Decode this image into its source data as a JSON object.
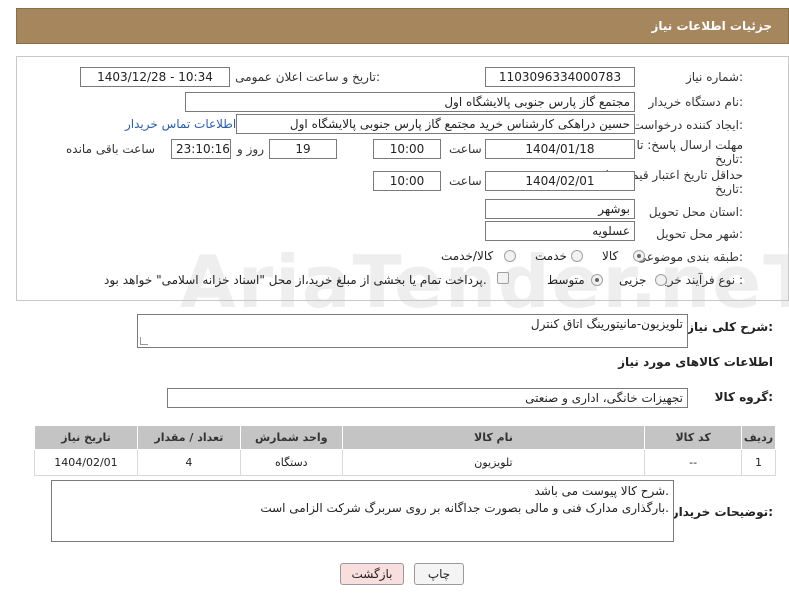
{
  "header": {
    "title": "جزئیات اطلاعات نیاز"
  },
  "form": {
    "need_number_label": "شماره نیاز:",
    "need_number": "1103096334000783",
    "announce_label": "تاریخ و ساعت اعلان عمومی:",
    "announce_value": "1403/12/28 - 10:34",
    "buyer_org_label": "نام دستگاه خریدار:",
    "buyer_org": "مجتمع گاز پارس جنوبی  پالایشگاه اول",
    "creator_label": "ایجاد کننده درخواست:",
    "creator": "حسین دراهکی کارشناس خرید مجتمع گاز پارس جنوبی  پالایشگاه اول",
    "buyer_contact_link": "اطلاعات تماس خریدار",
    "deadline_label_1": "مهلت ارسال پاسخ: تا",
    "deadline_label_2": "تاریخ:",
    "deadline_date": "1404/01/18",
    "time_label": "ساعت",
    "deadline_time": "10:00",
    "days_value": "19",
    "days_label": "روز و",
    "remaining_time": "23:10:16",
    "remaining_label": "ساعت باقی مانده",
    "validity_label_1": "حداقل تاریخ اعتبار قیمت: تا",
    "validity_label_2": "تاریخ:",
    "validity_date": "1404/02/01",
    "validity_time": "10:00",
    "province_label": "استان محل تحویل:",
    "province": "بوشهر",
    "city_label": "شهر محل تحویل:",
    "city": "عسلویه",
    "category_label": "طبقه بندی موضوعی:",
    "category_goods": "کالا",
    "category_service": "خدمت",
    "category_goods_service": "کالا/خدمت",
    "process_label": "نوع فرآیند خرید :",
    "process_partial": "جزیی",
    "process_medium": "متوسط",
    "payment_note": "پرداخت تمام یا بخشی از مبلغ خرید،از محل \"اسناد خزانه اسلامی\" خواهد بود."
  },
  "description": {
    "label": "شرح کلی نیاز:",
    "value": "تلویزیون-مانیتورینگ اتاق کنترل"
  },
  "goods_info": {
    "title": "اطلاعات کالاهای مورد نیاز",
    "group_label": "گروه کالا:",
    "group_value": "تجهیزات خانگی، اداری و صنعتی"
  },
  "table": {
    "headers": {
      "row": "ردیف",
      "code": "کد کالا",
      "name": "نام کالا",
      "unit": "واحد شمارش",
      "qty": "تعداد / مقدار",
      "date": "تاریخ نیاز"
    },
    "rows": [
      {
        "row": "1",
        "code": "--",
        "name": "تلویزیون",
        "unit": "دستگاه",
        "qty": "4",
        "date": "1404/02/01"
      }
    ]
  },
  "buyer_notes": {
    "label": "توضیحات خریدار:",
    "line1": "شرح کالا پیوست می باشد.",
    "line2": "بارگذاری مدارک فنی و مالی بصورت جداگانه بر روی سربرگ شرکت الزامی است."
  },
  "buttons": {
    "print": "چاپ",
    "back": "بازگشت"
  },
  "watermark": "AriaTender.neT",
  "colors": {
    "header_bg": "#a5865d",
    "back_button_bg": "#f9dede",
    "link": "#2a5db0"
  }
}
